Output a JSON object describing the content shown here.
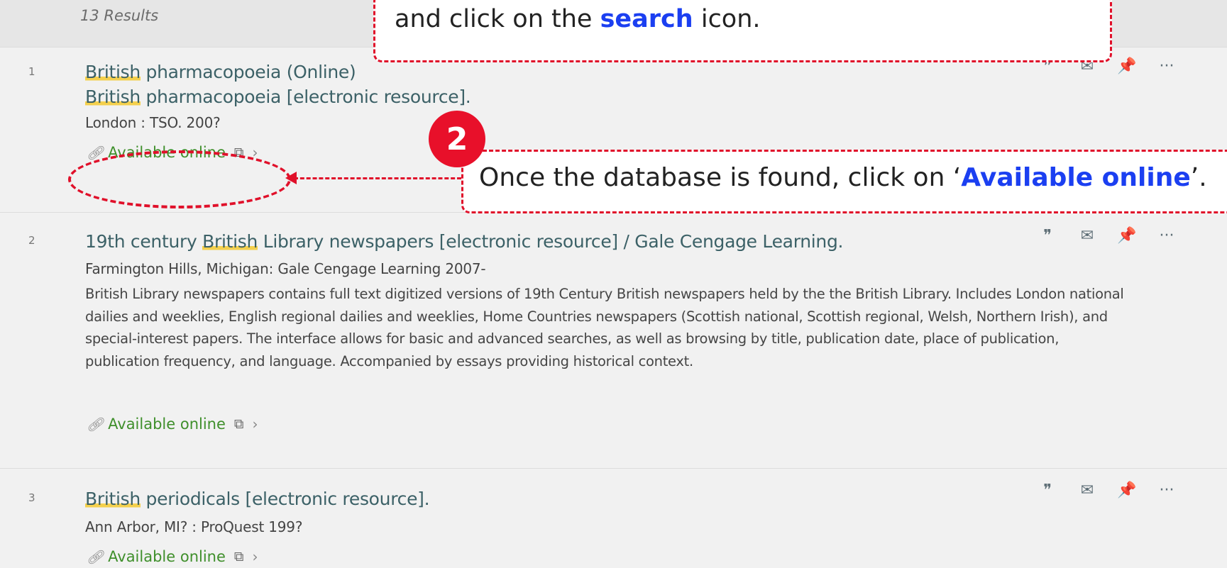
{
  "results_count": "13 Results",
  "actions": {
    "cite_icon": "❞",
    "email_icon": "✉",
    "pin_icon": "📌",
    "more_icon": "···"
  },
  "results": [
    {
      "index": "1",
      "title_line1_highlight": "British",
      "title_line1_rest": " pharmacopoeia (Online)",
      "title_line2_highlight": "British",
      "title_line2_rest": " pharmacopoeia [electronic resource].",
      "publisher": "London : TSO. 200?",
      "availability": "Available online"
    },
    {
      "index": "2",
      "title_prefix": "19th century ",
      "title_highlight": "British",
      "title_rest": " Library newspapers [electronic resource] / Gale Cengage Learning.",
      "publisher": "Farmington Hills, Michigan: Gale Cengage Learning 2007-",
      "description": "British Library newspapers contains full text digitized versions of 19th Century British newspapers held by the the British Library. Includes London national dailies and weeklies, English regional dailies and weeklies, Home Countries newspapers (Scottish national, Scottish regional, Welsh, Northern Irish), and special-interest papers. The interface allows for basic and advanced searches, as well as browsing by title, publication date, place of publication, publication frequency, and language. Accompanied by essays providing historical context.",
      "availability": "Available online"
    },
    {
      "index": "3",
      "title_highlight": "British",
      "title_rest": " periodicals [electronic resource].",
      "publisher": "Ann Arbor, MI? : ProQuest 199?",
      "availability": "Available online"
    }
  ],
  "annotations": {
    "callout1": {
      "text_before": "and click on the ",
      "text_bold": "search",
      "text_after": " icon."
    },
    "badge": "2",
    "callout2": {
      "text_before": "Once the database is found, click on ‘",
      "text_bold": "Available online",
      "text_after": "’."
    },
    "annotation_color": "#e0102a",
    "emphasis_color": "#1b3ff1"
  },
  "colors": {
    "title": "#3c6167",
    "available": "#3f8f2b",
    "highlight": "#f4d04d",
    "pin": "#1a8b86"
  }
}
